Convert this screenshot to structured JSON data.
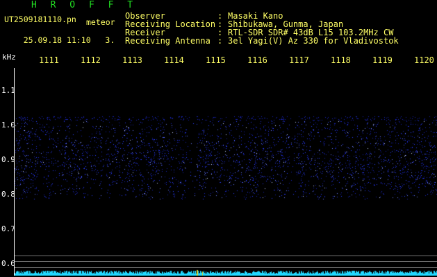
{
  "brand": {
    "logo": "H R O F F T"
  },
  "file": {
    "name": "UT2509181110.pn",
    "mode": "meteor",
    "datetime": "25.09.18 11:10",
    "extra": "3."
  },
  "header": [
    {
      "label": "Observer",
      "value": "Masaki Kano"
    },
    {
      "label": "Receiving Location",
      "value": "Shibukawa, Gunma, Japan"
    },
    {
      "label": "Receiver",
      "value": "RTL-SDR SDR# 43dB L15 103.2MHz CW"
    },
    {
      "label": "Receiving Antenna",
      "value": "3el Yagi(V) Az 330 for Vladivostok"
    }
  ],
  "axis": {
    "unit": "kHz",
    "time_ticks": [
      "1111",
      "1112",
      "1113",
      "1114",
      "1115",
      "1116",
      "1117",
      "1118",
      "1119",
      "1120"
    ],
    "freq_ticks": [
      {
        "label": "1.1",
        "value": 1.1
      },
      {
        "label": "1.0",
        "value": 1.0
      },
      {
        "label": "0.9",
        "value": 0.9
      },
      {
        "label": "0.8",
        "value": 0.8
      },
      {
        "label": "0.7",
        "value": 0.7
      },
      {
        "label": "0.6",
        "value": 0.6
      }
    ]
  },
  "colors": {
    "header_text": "#ffff66",
    "logo": "#22dd22",
    "noise": "#2a3cff",
    "trace": "#22d8ff"
  }
}
